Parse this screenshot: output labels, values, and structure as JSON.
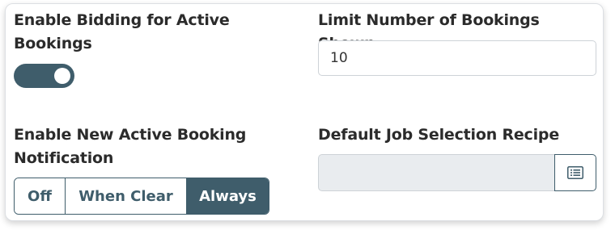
{
  "bidding": {
    "label": "Enable Bidding for Active Bookings",
    "enabled": true
  },
  "limit": {
    "label": "Limit Number of Bookings Shown",
    "value": "10"
  },
  "notification": {
    "label": "Enable New Active Booking Notification",
    "options": [
      "Off",
      "When Clear",
      "Always"
    ],
    "selected": "Always"
  },
  "recipe": {
    "label": "Default Job Selection Recipe",
    "value": "",
    "button_icon": "list-icon"
  },
  "colors": {
    "accent": "#3f5d6b",
    "disabled_field": "#e9ecef"
  }
}
